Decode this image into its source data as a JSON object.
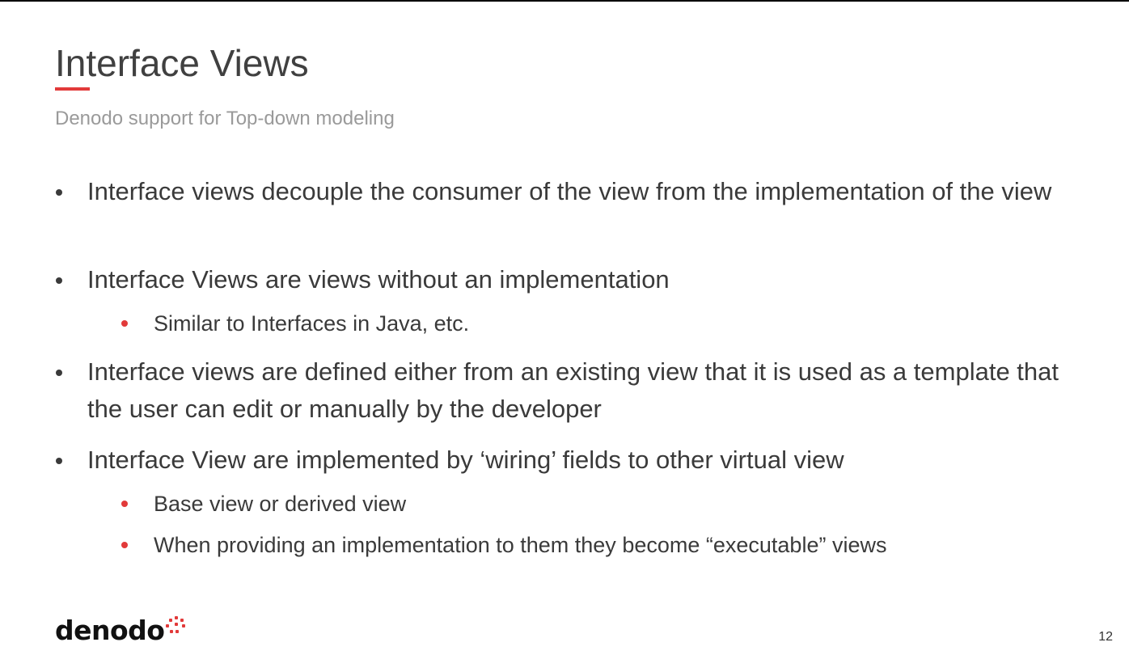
{
  "slide": {
    "title": "Interface Views",
    "subtitle": "Denodo support for Top-down modeling",
    "page_number": "12",
    "accent_color": "#e23a3a",
    "text_color": "#3a3a3a",
    "subtitle_color": "#9a9a9a"
  },
  "bullets": [
    {
      "level": 1,
      "text": "Interface views decouple the consumer of the view from the implementation of the view"
    },
    {
      "level": 1,
      "text": "Interface Views are views without an implementation"
    },
    {
      "level": 2,
      "text": "Similar to Interfaces in Java, etc."
    },
    {
      "level": 1,
      "text": "Interface views are defined either from an existing view that it is used as a template that the user can edit or manually by the developer"
    },
    {
      "level": 1,
      "text": "Interface View are implemented by ‘wiring’ fields to other virtual view"
    },
    {
      "level": 2,
      "text": "Base view or derived view"
    },
    {
      "level": 2,
      "text": "When providing an implementation to them they become “executable” views"
    }
  ],
  "logo": {
    "text": "denodo",
    "icon": "denodo-dots-logo-icon"
  }
}
